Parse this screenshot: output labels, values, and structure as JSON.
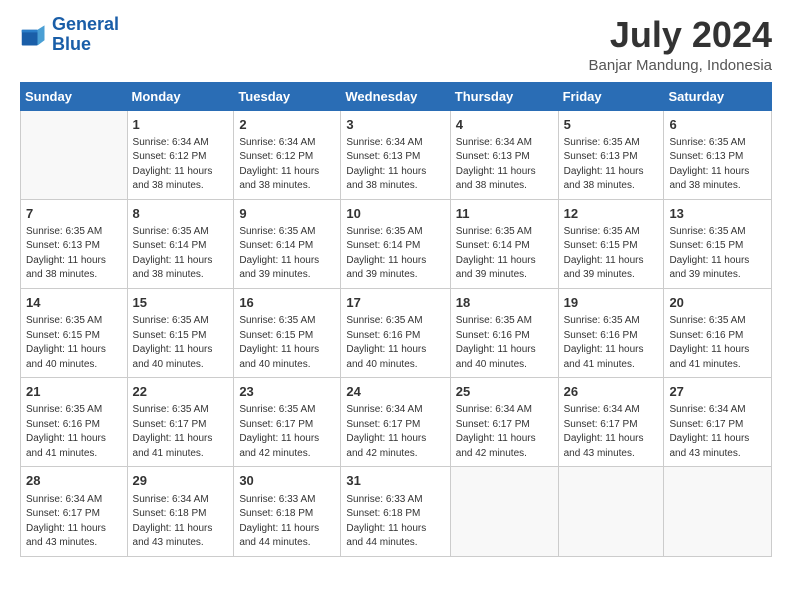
{
  "header": {
    "logo_line1": "General",
    "logo_line2": "Blue",
    "month_year": "July 2024",
    "location": "Banjar Mandung, Indonesia"
  },
  "days_of_week": [
    "Sunday",
    "Monday",
    "Tuesday",
    "Wednesday",
    "Thursday",
    "Friday",
    "Saturday"
  ],
  "weeks": [
    [
      {
        "day": "",
        "info": ""
      },
      {
        "day": "1",
        "info": "Sunrise: 6:34 AM\nSunset: 6:12 PM\nDaylight: 11 hours\nand 38 minutes."
      },
      {
        "day": "2",
        "info": "Sunrise: 6:34 AM\nSunset: 6:12 PM\nDaylight: 11 hours\nand 38 minutes."
      },
      {
        "day": "3",
        "info": "Sunrise: 6:34 AM\nSunset: 6:13 PM\nDaylight: 11 hours\nand 38 minutes."
      },
      {
        "day": "4",
        "info": "Sunrise: 6:34 AM\nSunset: 6:13 PM\nDaylight: 11 hours\nand 38 minutes."
      },
      {
        "day": "5",
        "info": "Sunrise: 6:35 AM\nSunset: 6:13 PM\nDaylight: 11 hours\nand 38 minutes."
      },
      {
        "day": "6",
        "info": "Sunrise: 6:35 AM\nSunset: 6:13 PM\nDaylight: 11 hours\nand 38 minutes."
      }
    ],
    [
      {
        "day": "7",
        "info": "Sunrise: 6:35 AM\nSunset: 6:13 PM\nDaylight: 11 hours\nand 38 minutes."
      },
      {
        "day": "8",
        "info": "Sunrise: 6:35 AM\nSunset: 6:14 PM\nDaylight: 11 hours\nand 38 minutes."
      },
      {
        "day": "9",
        "info": "Sunrise: 6:35 AM\nSunset: 6:14 PM\nDaylight: 11 hours\nand 39 minutes."
      },
      {
        "day": "10",
        "info": "Sunrise: 6:35 AM\nSunset: 6:14 PM\nDaylight: 11 hours\nand 39 minutes."
      },
      {
        "day": "11",
        "info": "Sunrise: 6:35 AM\nSunset: 6:14 PM\nDaylight: 11 hours\nand 39 minutes."
      },
      {
        "day": "12",
        "info": "Sunrise: 6:35 AM\nSunset: 6:15 PM\nDaylight: 11 hours\nand 39 minutes."
      },
      {
        "day": "13",
        "info": "Sunrise: 6:35 AM\nSunset: 6:15 PM\nDaylight: 11 hours\nand 39 minutes."
      }
    ],
    [
      {
        "day": "14",
        "info": "Sunrise: 6:35 AM\nSunset: 6:15 PM\nDaylight: 11 hours\nand 40 minutes."
      },
      {
        "day": "15",
        "info": "Sunrise: 6:35 AM\nSunset: 6:15 PM\nDaylight: 11 hours\nand 40 minutes."
      },
      {
        "day": "16",
        "info": "Sunrise: 6:35 AM\nSunset: 6:15 PM\nDaylight: 11 hours\nand 40 minutes."
      },
      {
        "day": "17",
        "info": "Sunrise: 6:35 AM\nSunset: 6:16 PM\nDaylight: 11 hours\nand 40 minutes."
      },
      {
        "day": "18",
        "info": "Sunrise: 6:35 AM\nSunset: 6:16 PM\nDaylight: 11 hours\nand 40 minutes."
      },
      {
        "day": "19",
        "info": "Sunrise: 6:35 AM\nSunset: 6:16 PM\nDaylight: 11 hours\nand 41 minutes."
      },
      {
        "day": "20",
        "info": "Sunrise: 6:35 AM\nSunset: 6:16 PM\nDaylight: 11 hours\nand 41 minutes."
      }
    ],
    [
      {
        "day": "21",
        "info": "Sunrise: 6:35 AM\nSunset: 6:16 PM\nDaylight: 11 hours\nand 41 minutes."
      },
      {
        "day": "22",
        "info": "Sunrise: 6:35 AM\nSunset: 6:17 PM\nDaylight: 11 hours\nand 41 minutes."
      },
      {
        "day": "23",
        "info": "Sunrise: 6:35 AM\nSunset: 6:17 PM\nDaylight: 11 hours\nand 42 minutes."
      },
      {
        "day": "24",
        "info": "Sunrise: 6:34 AM\nSunset: 6:17 PM\nDaylight: 11 hours\nand 42 minutes."
      },
      {
        "day": "25",
        "info": "Sunrise: 6:34 AM\nSunset: 6:17 PM\nDaylight: 11 hours\nand 42 minutes."
      },
      {
        "day": "26",
        "info": "Sunrise: 6:34 AM\nSunset: 6:17 PM\nDaylight: 11 hours\nand 43 minutes."
      },
      {
        "day": "27",
        "info": "Sunrise: 6:34 AM\nSunset: 6:17 PM\nDaylight: 11 hours\nand 43 minutes."
      }
    ],
    [
      {
        "day": "28",
        "info": "Sunrise: 6:34 AM\nSunset: 6:17 PM\nDaylight: 11 hours\nand 43 minutes."
      },
      {
        "day": "29",
        "info": "Sunrise: 6:34 AM\nSunset: 6:18 PM\nDaylight: 11 hours\nand 43 minutes."
      },
      {
        "day": "30",
        "info": "Sunrise: 6:33 AM\nSunset: 6:18 PM\nDaylight: 11 hours\nand 44 minutes."
      },
      {
        "day": "31",
        "info": "Sunrise: 6:33 AM\nSunset: 6:18 PM\nDaylight: 11 hours\nand 44 minutes."
      },
      {
        "day": "",
        "info": ""
      },
      {
        "day": "",
        "info": ""
      },
      {
        "day": "",
        "info": ""
      }
    ]
  ]
}
